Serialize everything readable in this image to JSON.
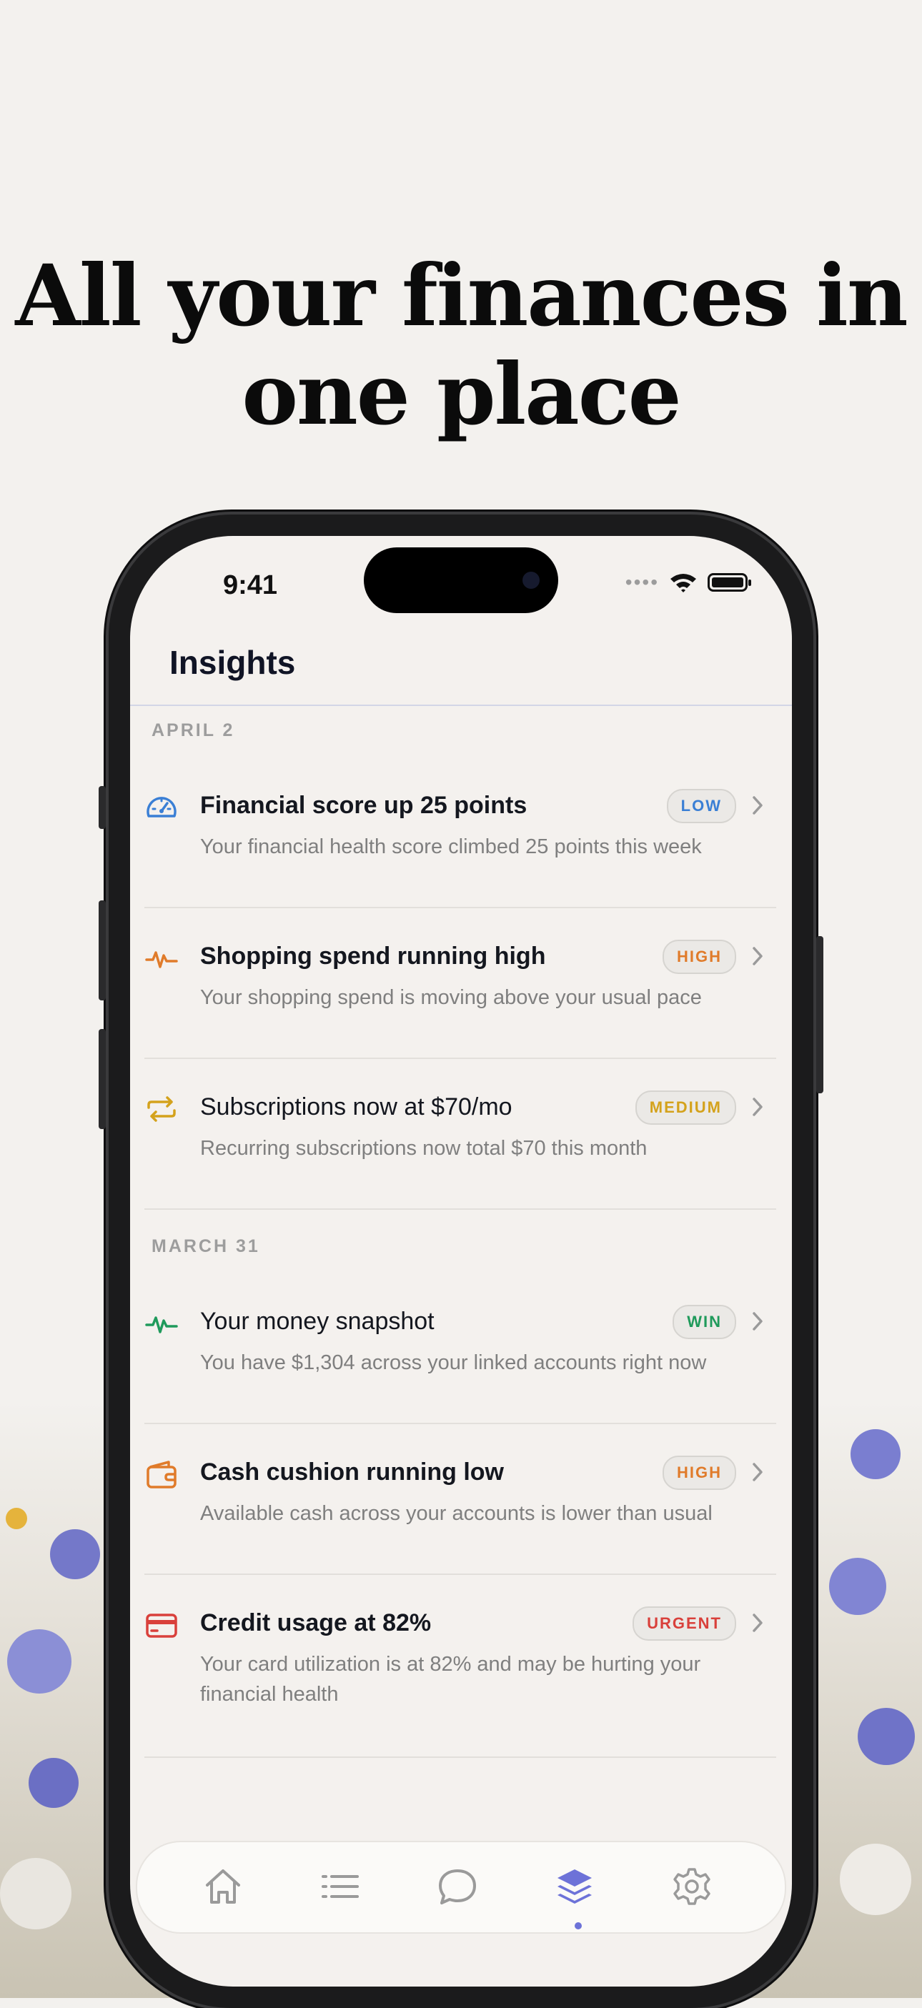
{
  "headline": "All your finances in one place",
  "status_bar": {
    "time": "9:41",
    "signal_dots": "••••"
  },
  "screen": {
    "title": "Insights",
    "sections": [
      {
        "date": "APRIL 2",
        "items": [
          {
            "icon": "gauge-icon",
            "title": "Financial score up 25 points",
            "description": "Your financial health score climbed 25 points this week",
            "badge": "LOW",
            "badge_color": "#3a7fd5"
          },
          {
            "icon": "activity-icon",
            "title": "Shopping spend running high",
            "description": "Your shopping spend is moving above your usual pace",
            "badge": "HIGH",
            "badge_color": "#e07b2a"
          },
          {
            "icon": "repeat-icon",
            "title": "Subscriptions now at $70/mo",
            "description": "Recurring subscriptions now total $70 this month",
            "badge": "MEDIUM",
            "badge_color": "#d4a21c"
          }
        ]
      },
      {
        "date": "MARCH 31",
        "items": [
          {
            "icon": "pulse-icon",
            "title": "Your money snapshot",
            "description": "You have $1,304 across your linked accounts right now",
            "badge": "WIN",
            "badge_color": "#1f9a5b"
          },
          {
            "icon": "wallet-icon",
            "title": "Cash cushion running low",
            "description": "Available cash across your accounts is lower than usual",
            "badge": "HIGH",
            "badge_color": "#e07b2a"
          },
          {
            "icon": "credit-card-icon",
            "title": "Credit usage at 82%",
            "description": "Your card utilization is at 82% and may be hurting your financial health",
            "badge": "URGENT",
            "badge_color": "#d9403b"
          }
        ]
      }
    ],
    "tab_bar": {
      "tabs": [
        "home-icon",
        "list-icon",
        "chat-icon",
        "layers-icon",
        "gear-icon"
      ],
      "active_tab": "layers-icon",
      "active_color": "#6d72d8",
      "inactive_color": "#9a9a9a"
    }
  }
}
